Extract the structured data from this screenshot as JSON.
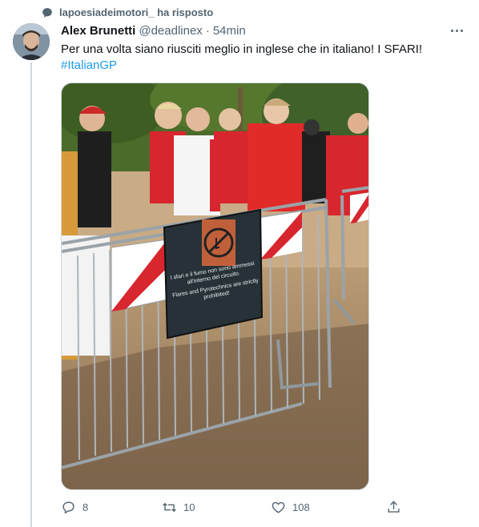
{
  "reply_context": {
    "icon": "speech-bubble-icon",
    "text": "lapoesiadeimotori_ ha risposto"
  },
  "tweet": {
    "author_name": "Alex Brunetti",
    "author_handle": "@deadlinex",
    "separator": "·",
    "time": "54min",
    "text": "Per una volta siano riusciti meglio in inglese che in italiano! I SFARI!",
    "hashtag": "#ItalianGP",
    "more_icon": "more-dots-icon"
  },
  "media": {
    "sign_text_it": "I sfari e il fumo non sono ammessi all'interno del circuito.",
    "sign_text_en": "Flares and Pyrotechnics are strictly prohibited!"
  },
  "actions": {
    "reply_count": "8",
    "retweet_count": "10",
    "like_count": "108",
    "reply_icon": "reply-icon",
    "retweet_icon": "retweet-icon",
    "like_icon": "heart-icon",
    "share_icon": "share-icon"
  },
  "colors": {
    "text_primary": "#0f1419",
    "text_secondary": "#536471",
    "link": "#1d9bf0",
    "border": "#cfd9de"
  }
}
